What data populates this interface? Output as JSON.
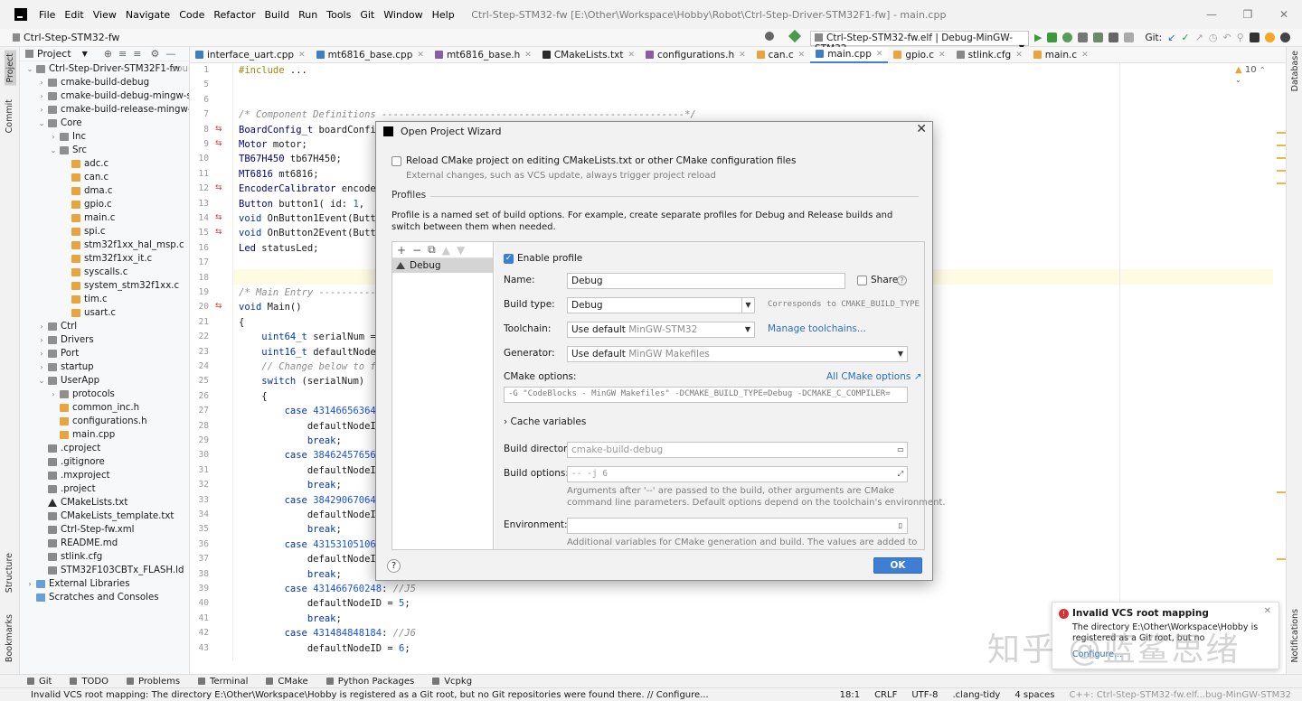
{
  "menu": [
    "File",
    "Edit",
    "View",
    "Navigate",
    "Code",
    "Refactor",
    "Build",
    "Run",
    "Tools",
    "Git",
    "Window",
    "Help"
  ],
  "window_title": "Ctrl-Step-STM32-fw [E:\\Other\\Workspace\\Hobby\\Robot\\Ctrl-Step-Driver-STM32F1-fw] - main.cpp",
  "nav": {
    "project": "Ctrl-Step-STM32-fw",
    "run_config": "Ctrl-Step-STM32-fw.elf | Debug-MinGW-STM32",
    "git_label": "Git:"
  },
  "left_stripe": {
    "project": "Project",
    "commit": "Commit",
    "structure": "Structure",
    "bookmarks": "Bookmarks"
  },
  "right_stripe": {
    "database": "Database",
    "notifications": "Notifications"
  },
  "project_panel": {
    "title": "Project",
    "items": [
      {
        "label": "Ctrl-Step-Driver-STM32F1-fw",
        "suffix": "sourc",
        "depth": 0,
        "arrow": "v",
        "icon": "folder"
      },
      {
        "label": "cmake-build-debug",
        "depth": 1,
        "arrow": ">",
        "icon": "folder"
      },
      {
        "label": "cmake-build-debug-mingw-stm3",
        "depth": 1,
        "arrow": ">",
        "icon": "folder"
      },
      {
        "label": "cmake-build-release-mingw-stm.",
        "depth": 1,
        "arrow": ">",
        "icon": "folder"
      },
      {
        "label": "Core",
        "depth": 1,
        "arrow": "v",
        "icon": "folder"
      },
      {
        "label": "Inc",
        "depth": 2,
        "arrow": ">",
        "icon": "folder"
      },
      {
        "label": "Src",
        "depth": 2,
        "arrow": "v",
        "icon": "folder"
      },
      {
        "label": "adc.c",
        "depth": 3,
        "icon": "file"
      },
      {
        "label": "can.c",
        "depth": 3,
        "icon": "file"
      },
      {
        "label": "dma.c",
        "depth": 3,
        "icon": "file"
      },
      {
        "label": "gpio.c",
        "depth": 3,
        "icon": "file"
      },
      {
        "label": "main.c",
        "depth": 3,
        "icon": "file"
      },
      {
        "label": "spi.c",
        "depth": 3,
        "icon": "file"
      },
      {
        "label": "stm32f1xx_hal_msp.c",
        "depth": 3,
        "icon": "file"
      },
      {
        "label": "stm32f1xx_it.c",
        "depth": 3,
        "icon": "file"
      },
      {
        "label": "syscalls.c",
        "depth": 3,
        "icon": "file"
      },
      {
        "label": "system_stm32f1xx.c",
        "depth": 3,
        "icon": "file"
      },
      {
        "label": "tim.c",
        "depth": 3,
        "icon": "file"
      },
      {
        "label": "usart.c",
        "depth": 3,
        "icon": "file"
      },
      {
        "label": "Ctrl",
        "depth": 1,
        "arrow": ">",
        "icon": "folder"
      },
      {
        "label": "Drivers",
        "depth": 1,
        "arrow": ">",
        "icon": "folder"
      },
      {
        "label": "Port",
        "depth": 1,
        "arrow": ">",
        "icon": "folder"
      },
      {
        "label": "startup",
        "depth": 1,
        "arrow": ">",
        "icon": "folder"
      },
      {
        "label": "UserApp",
        "depth": 1,
        "arrow": "v",
        "icon": "folder"
      },
      {
        "label": "protocols",
        "depth": 2,
        "arrow": ">",
        "icon": "folder"
      },
      {
        "label": "common_inc.h",
        "depth": 2,
        "icon": "file"
      },
      {
        "label": "configurations.h",
        "depth": 2,
        "icon": "file"
      },
      {
        "label": "main.cpp",
        "depth": 2,
        "icon": "file"
      },
      {
        "label": ".cproject",
        "depth": 1,
        "icon": "text"
      },
      {
        "label": ".gitignore",
        "depth": 1,
        "icon": "text"
      },
      {
        "label": ".mxproject",
        "depth": 1,
        "icon": "text"
      },
      {
        "label": ".project",
        "depth": 1,
        "icon": "text"
      },
      {
        "label": "CMakeLists.txt",
        "depth": 1,
        "icon": "cmake"
      },
      {
        "label": "CMakeLists_template.txt",
        "depth": 1,
        "icon": "text"
      },
      {
        "label": "Ctrl-Step-fw.xml",
        "depth": 1,
        "icon": "text"
      },
      {
        "label": "README.md",
        "depth": 1,
        "icon": "text"
      },
      {
        "label": "stlink.cfg",
        "depth": 1,
        "icon": "text"
      },
      {
        "label": "STM32F103CBTx_FLASH.ld",
        "depth": 1,
        "icon": "text"
      },
      {
        "label": "External Libraries",
        "depth": 0,
        "arrow": ">",
        "icon": "folder"
      },
      {
        "label": "Scratches and Consoles",
        "depth": 0,
        "icon": "folder"
      }
    ]
  },
  "tabs": [
    {
      "label": "interface_uart.cpp",
      "color": "#3f7fbf"
    },
    {
      "label": "mt6816_base.cpp",
      "color": "#3f7fbf"
    },
    {
      "label": "mt6816_base.h",
      "color": "#8a5ca3"
    },
    {
      "label": "CMakeLists.txt",
      "color": "#2a2a2a"
    },
    {
      "label": "configurations.h",
      "color": "#8a5ca3"
    },
    {
      "label": "can.c",
      "color": "#e8a53f"
    },
    {
      "label": "main.cpp",
      "color": "#3f7fbf",
      "active": true
    },
    {
      "label": "gpio.c",
      "color": "#e8a53f"
    },
    {
      "label": "stlink.cfg",
      "color": "#888888"
    },
    {
      "label": "main.c",
      "color": "#e8a53f"
    }
  ],
  "warnings_count": "10",
  "code": {
    "line_numbers": [
      "1",
      "5",
      "6",
      "7",
      "8",
      "9",
      "10",
      "11",
      "12",
      "13",
      "14",
      "15",
      "16",
      "17",
      "18",
      "19",
      "20",
      "21",
      "22",
      "23",
      "24",
      "25",
      "26",
      "27",
      "28",
      "29",
      "30",
      "31",
      "32",
      "33",
      "34",
      "35",
      "36",
      "37",
      "38",
      "39",
      "40",
      "41",
      "42",
      "43"
    ],
    "lines": [
      "#include ...",
      "",
      "",
      "/* Component Definitions -----------------------------------------------------*/",
      "BoardConfig_t boardConfig",
      "Motor motor;",
      "TB67H450 tb67H450;",
      "MT6816 mt6816;",
      "EncoderCalibrator encoder",
      "Button button1( id: 1,  long",
      "void OnButton1Event(Butto",
      "void OnButton2Event(Butto",
      "Led statusLed;",
      "",
      "",
      "/* Main Entry -----------",
      "void Main()",
      "{",
      "    uint64_t serialNum = (",
      "    uint16_t defaultNodeI",
      "    // Change below to fi",
      "    switch (serialNum)",
      "    {",
      "        case 431466563640",
      "            defaultNodeID",
      "            break;",
      "        case 384624576568",
      "            defaultNodeID",
      "            break;",
      "        case 384290670648",
      "            defaultNodeID",
      "            break;",
      "        case 431531051064",
      "            defaultNodeID",
      "            break;",
      "        case 431466760248: //J5",
      "            defaultNodeID = 5;",
      "            break;",
      "        case 431484848184: //J6",
      "            defaultNodeID = 6;"
    ]
  },
  "dialog": {
    "title": "Open Project Wizard",
    "reload_label": "Reload CMake project on editing CMakeLists.txt or other CMake configuration files",
    "reload_sub": "External changes, such as VCS update, always trigger project reload",
    "profiles_header": "Profiles",
    "profiles_desc": "Profile is a named set of build options. For example, create separate profiles for Debug and Release builds and switch between them when needed.",
    "profile_item": "Debug",
    "enable_profile": "Enable profile",
    "name_label": "Name:",
    "name_value": "Debug",
    "share_label": "Share",
    "build_type_label": "Build type:",
    "build_type_value": "Debug",
    "build_type_note": "Corresponds to CMAKE_BUILD_TYPE",
    "toolchain_label": "Toolchain:",
    "toolchain_value": "Use default",
    "toolchain_hint": "MinGW-STM32",
    "manage_toolchains": "Manage toolchains...",
    "generator_label": "Generator:",
    "generator_value": "Use default",
    "generator_hint": "MinGW Makefiles",
    "cmake_options_label": "CMake options:",
    "all_cmake_options": "All CMake options ↗",
    "cmake_options_value": "-G \"CodeBlocks - MinGW Makefiles\" -DCMAKE_BUILD_TYPE=Debug -DCMAKE_C_COMPILER=",
    "cache_variables": "Cache variables",
    "build_dir_label": "Build directory:",
    "build_dir_placeholder": "cmake-build-debug",
    "build_opts_label": "Build options:",
    "build_opts_placeholder": "-- -j 6",
    "build_opts_note1": "Arguments after '--' are passed to the build, other arguments are CMake",
    "build_opts_note2": "command line parameters. Default options depend on the toolchain's environment.",
    "env_label": "Environment:",
    "env_note": "Additional variables for CMake generation and build. The values are added to",
    "ok": "OK",
    "help": "?"
  },
  "notification": {
    "title": "Invalid VCS root mapping",
    "body": "The directory E:\\Other\\Workspace\\Hobby is registered as a Git root, but no",
    "link": "Configure..."
  },
  "watermark": "知乎 @蓝鲨思绪",
  "toolwindows": [
    "Git",
    "TODO",
    "Problems",
    "Terminal",
    "CMake",
    "Python Packages",
    "Vcpkg"
  ],
  "status": {
    "message": "Invalid VCS root mapping: The directory E:\\Other\\Workspace\\Hobby is registered as a Git root, but no Git repositories were found there. // Configure...",
    "position": "18:1",
    "line_sep": "CRLF",
    "encoding": "UTF-8",
    "linter": ".clang-tidy",
    "indent": "4 spaces",
    "context": "C++: Ctrl-Step-STM32-fw.elf...bug-MinGW-STM32"
  }
}
